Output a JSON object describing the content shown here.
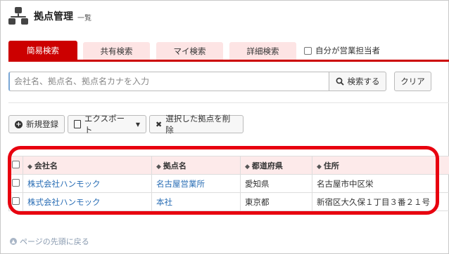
{
  "header": {
    "title": "拠点管理",
    "subtitle": "一覧"
  },
  "tabs": [
    {
      "label": "簡易検索",
      "active": true
    },
    {
      "label": "共有検索",
      "active": false
    },
    {
      "label": "マイ検索",
      "active": false
    },
    {
      "label": "詳細検索",
      "active": false
    }
  ],
  "own_filter_label": "自分が営業担当者",
  "search": {
    "placeholder": "会社名、拠点名、拠点名カナを入力",
    "value": "",
    "search_button": "検索する",
    "clear_button": "クリア"
  },
  "actions": {
    "new_label": "新規登録",
    "export_label": "エクスポート",
    "delete_label": "選択した拠点を削除"
  },
  "table": {
    "columns": [
      "会社名",
      "拠点名",
      "都道府県",
      "住所"
    ],
    "rows": [
      [
        "株式会社ハンモック",
        "名古屋営業所",
        "愛知県",
        "名古屋市中区栄"
      ],
      [
        "株式会社ハンモック",
        "本社",
        "東京都",
        "新宿区大久保１丁目３番２１号"
      ]
    ]
  },
  "back_to_top": "ページの先頭に戻る",
  "colors": {
    "accent": "#cc0000",
    "tab_inactive": "#fde4e4",
    "link": "#2a6eb5",
    "highlight_outline": "#e8000f"
  }
}
